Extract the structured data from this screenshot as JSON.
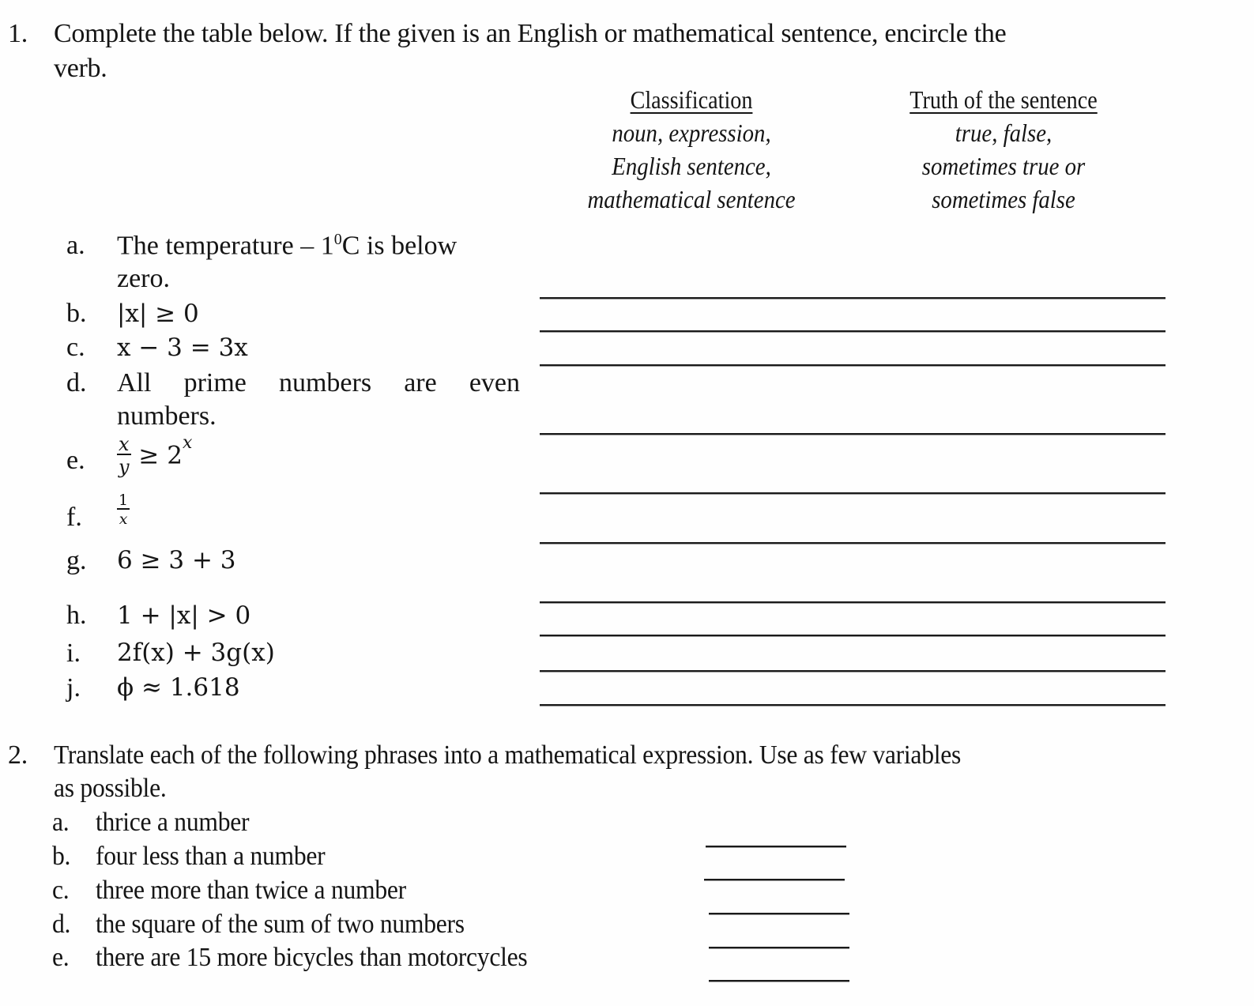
{
  "question1": {
    "number": "1.",
    "instruction_line1": "Complete the table below. If the given is an English or mathematical sentence, encircle the",
    "instruction_line2": "verb.",
    "columns": {
      "classification": {
        "header": "Classification",
        "options": [
          "noun, expression,",
          "English sentence,",
          "mathematical sentence"
        ]
      },
      "truth": {
        "header": "Truth of the sentence",
        "options": [
          "true, false,",
          "sometimes true or",
          "sometimes false"
        ]
      }
    },
    "items": [
      {
        "label": "a.",
        "line1": "The temperature – 1",
        "sup": "0",
        "line1_end": "C is below",
        "line2": "zero."
      },
      {
        "label": "b.",
        "text": "|x| ≥ 0"
      },
      {
        "label": "c.",
        "text": "x − 3 = 3x"
      },
      {
        "label": "d.",
        "line1": "All prime numbers are even",
        "line2": "numbers."
      },
      {
        "label": "e.",
        "frac_num": "x",
        "frac_den": "y",
        "rest": "≥ 2",
        "sup": "x"
      },
      {
        "label": "f.",
        "frac_num": "1",
        "frac_den": "x"
      },
      {
        "label": "g.",
        "text": "6 ≥ 3 + 3"
      },
      {
        "label": "h.",
        "text": "1 + |x| > 0"
      },
      {
        "label": "i.",
        "text": "2f(x) + 3g(x)"
      },
      {
        "label": "j.",
        "text": "ϕ ≈ 1.618"
      }
    ]
  },
  "question2": {
    "number": "2.",
    "instruction_line1": "Translate each of the following phrases into a mathematical expression. Use as few variables",
    "instruction_line2": "as possible.",
    "items": [
      {
        "label": "a.",
        "text": "thrice a number"
      },
      {
        "label": "b.",
        "text": "four less than a number"
      },
      {
        "label": "c.",
        "text": "three more than twice a number"
      },
      {
        "label": "d.",
        "text": "the square of the sum of two numbers"
      },
      {
        "label": "e.",
        "text": "there are 15 more bicycles than motorcycles"
      }
    ]
  }
}
